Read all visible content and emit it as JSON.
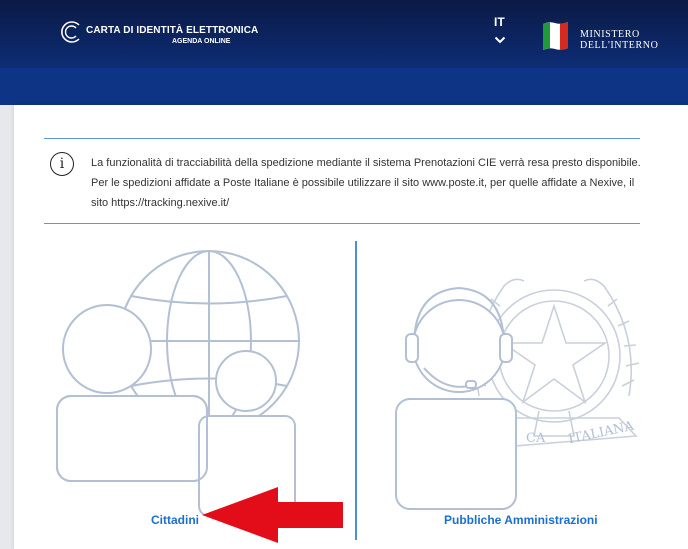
{
  "header": {
    "brand_title": "CARTA DI IDENTITÀ ELETTRONICA",
    "brand_subtitle": "AGENDA ONLINE",
    "language": "IT",
    "ministry_line1": "MINISTERO",
    "ministry_line2": "DELL'INTERNO"
  },
  "notice": {
    "icon": "info-icon",
    "line1": "La funzionalità di tracciabilità della spedizione mediante il sistema Prenotazioni CIE verrà resa presto disponibile.",
    "line2": "Per le spedizioni affidate a Poste Italiane è possibile utilizzare il sito www.poste.it, per quelle affidate a Nexive, il",
    "line3": "sito https://tracking.nexive.it/"
  },
  "choices": {
    "citizens_label": "Cittadini",
    "pa_label": "Pubbliche Amministrazioni"
  },
  "emblem_text": {
    "left": "CA",
    "right": "ITALIANA"
  },
  "colors": {
    "header": "#0d2a6e",
    "accent": "#1a6fd1",
    "illustration": "#b3bfd3",
    "arrow": "#e30d1a"
  }
}
